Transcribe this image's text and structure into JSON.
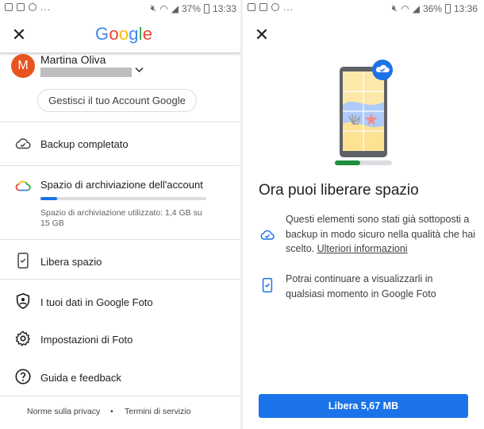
{
  "left": {
    "status": {
      "battery": "37%",
      "time": "13:33"
    },
    "logo": "Google",
    "account": {
      "initial": "M",
      "name": "Martina Oliva",
      "manage_label": "Gestisci il tuo Account Google"
    },
    "backup_label": "Backup completato",
    "storage": {
      "label": "Spazio di archiviazione dell'account",
      "usage_text": "Spazio di archiviazione utilizzato: 1,4 GB su 15 GB",
      "used_fraction": 0.093
    },
    "menu": [
      {
        "label": "Libera spazio",
        "icon": "phone-check-icon"
      },
      {
        "label": "I tuoi dati in Google Foto",
        "icon": "shield-person-icon"
      },
      {
        "label": "Impostazioni di Foto",
        "icon": "gear-icon"
      },
      {
        "label": "Guida e feedback",
        "icon": "help-icon"
      }
    ],
    "footer": {
      "privacy": "Norme sulla privacy",
      "separator": "•",
      "terms": "Termini di servizio"
    }
  },
  "right": {
    "status": {
      "battery": "36%",
      "time": "13:36"
    },
    "progress_fraction": 0.45,
    "title": "Ora puoi liberare spazio",
    "para1": "Questi elementi sono stati già sottoposti a backup in modo sicuro nella qualità che hai scelto.",
    "para1_link": "Ulteriori informazioni",
    "para2": "Potrai continuare a visualizzarli in qualsiasi momento in Google Foto",
    "button_label": "Libera 5,67 MB"
  },
  "colors": {
    "accent": "#1a73e8",
    "avatar": "#e8541f",
    "progress_green": "#1e8e3e"
  }
}
